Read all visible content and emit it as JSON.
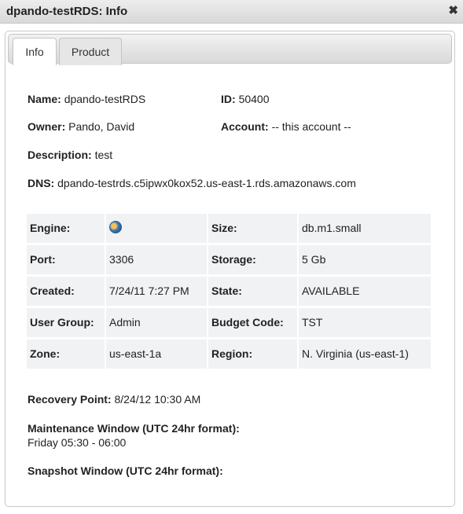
{
  "window": {
    "title": "dpando-testRDS: Info",
    "close_glyph": "✖"
  },
  "tabs": [
    {
      "label": "Info",
      "active": true
    },
    {
      "label": "Product",
      "active": false
    }
  ],
  "info": {
    "name_label": "Name:",
    "name_value": "dpando-testRDS",
    "id_label": "ID:",
    "id_value": "50400",
    "owner_label": "Owner:",
    "owner_value": "Pando, David",
    "account_label": "Account:",
    "account_value": "-- this account --",
    "description_label": "Description:",
    "description_value": "test",
    "dns_label": "DNS:",
    "dns_value": "dpando-testrds.c5ipwx0kox52.us-east-1.rds.amazonaws.com"
  },
  "details": {
    "engine_label": "Engine:",
    "engine_icon": "database-engine-icon",
    "size_label": "Size:",
    "size_value": "db.m1.small",
    "port_label": "Port:",
    "port_value": "3306",
    "storage_label": "Storage:",
    "storage_value": "5 Gb",
    "created_label": "Created:",
    "created_value": "7/24/11 7:27 PM",
    "state_label": "State:",
    "state_value": "AVAILABLE",
    "usergroup_label": "User Group:",
    "usergroup_value": "Admin",
    "budget_label": "Budget Code:",
    "budget_value": "TST",
    "zone_label": "Zone:",
    "zone_value": "us-east-1a",
    "region_label": "Region:",
    "region_value": "N. Virginia (us-east-1)"
  },
  "extra": {
    "recovery_label": "Recovery Point:",
    "recovery_value": "8/24/12 10:30 AM",
    "maintenance_label": "Maintenance Window (UTC 24hr format):",
    "maintenance_value": "Friday 05:30 - 06:00",
    "snapshot_label": "Snapshot Window (UTC 24hr format):",
    "snapshot_value": ""
  },
  "colors": {
    "cell_bg": "#f0f2f3",
    "titlebar_bg": "#e2e2e2"
  }
}
